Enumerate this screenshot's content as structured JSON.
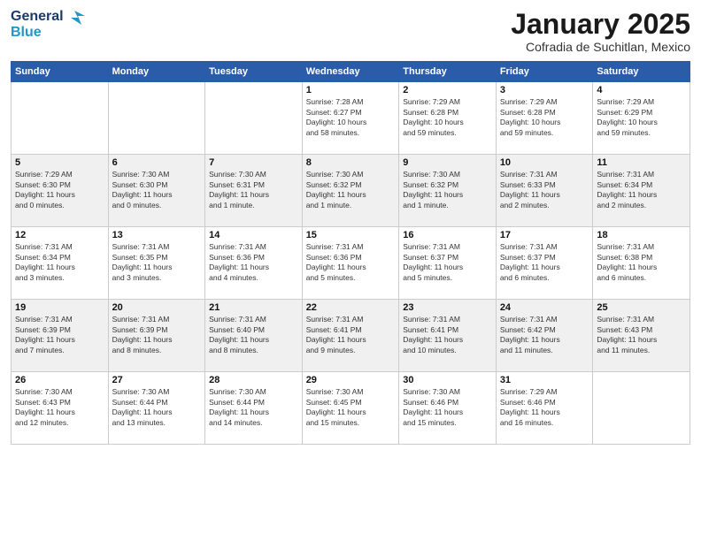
{
  "header": {
    "logo_general": "General",
    "logo_blue": "Blue",
    "month_title": "January 2025",
    "location": "Cofradia de Suchitlan, Mexico"
  },
  "weekdays": [
    "Sunday",
    "Monday",
    "Tuesday",
    "Wednesday",
    "Thursday",
    "Friday",
    "Saturday"
  ],
  "weeks": [
    [
      {
        "day": "",
        "info": ""
      },
      {
        "day": "",
        "info": ""
      },
      {
        "day": "",
        "info": ""
      },
      {
        "day": "1",
        "info": "Sunrise: 7:28 AM\nSunset: 6:27 PM\nDaylight: 10 hours\nand 58 minutes."
      },
      {
        "day": "2",
        "info": "Sunrise: 7:29 AM\nSunset: 6:28 PM\nDaylight: 10 hours\nand 59 minutes."
      },
      {
        "day": "3",
        "info": "Sunrise: 7:29 AM\nSunset: 6:28 PM\nDaylight: 10 hours\nand 59 minutes."
      },
      {
        "day": "4",
        "info": "Sunrise: 7:29 AM\nSunset: 6:29 PM\nDaylight: 10 hours\nand 59 minutes."
      }
    ],
    [
      {
        "day": "5",
        "info": "Sunrise: 7:29 AM\nSunset: 6:30 PM\nDaylight: 11 hours\nand 0 minutes."
      },
      {
        "day": "6",
        "info": "Sunrise: 7:30 AM\nSunset: 6:30 PM\nDaylight: 11 hours\nand 0 minutes."
      },
      {
        "day": "7",
        "info": "Sunrise: 7:30 AM\nSunset: 6:31 PM\nDaylight: 11 hours\nand 1 minute."
      },
      {
        "day": "8",
        "info": "Sunrise: 7:30 AM\nSunset: 6:32 PM\nDaylight: 11 hours\nand 1 minute."
      },
      {
        "day": "9",
        "info": "Sunrise: 7:30 AM\nSunset: 6:32 PM\nDaylight: 11 hours\nand 1 minute."
      },
      {
        "day": "10",
        "info": "Sunrise: 7:31 AM\nSunset: 6:33 PM\nDaylight: 11 hours\nand 2 minutes."
      },
      {
        "day": "11",
        "info": "Sunrise: 7:31 AM\nSunset: 6:34 PM\nDaylight: 11 hours\nand 2 minutes."
      }
    ],
    [
      {
        "day": "12",
        "info": "Sunrise: 7:31 AM\nSunset: 6:34 PM\nDaylight: 11 hours\nand 3 minutes."
      },
      {
        "day": "13",
        "info": "Sunrise: 7:31 AM\nSunset: 6:35 PM\nDaylight: 11 hours\nand 3 minutes."
      },
      {
        "day": "14",
        "info": "Sunrise: 7:31 AM\nSunset: 6:36 PM\nDaylight: 11 hours\nand 4 minutes."
      },
      {
        "day": "15",
        "info": "Sunrise: 7:31 AM\nSunset: 6:36 PM\nDaylight: 11 hours\nand 5 minutes."
      },
      {
        "day": "16",
        "info": "Sunrise: 7:31 AM\nSunset: 6:37 PM\nDaylight: 11 hours\nand 5 minutes."
      },
      {
        "day": "17",
        "info": "Sunrise: 7:31 AM\nSunset: 6:37 PM\nDaylight: 11 hours\nand 6 minutes."
      },
      {
        "day": "18",
        "info": "Sunrise: 7:31 AM\nSunset: 6:38 PM\nDaylight: 11 hours\nand 6 minutes."
      }
    ],
    [
      {
        "day": "19",
        "info": "Sunrise: 7:31 AM\nSunset: 6:39 PM\nDaylight: 11 hours\nand 7 minutes."
      },
      {
        "day": "20",
        "info": "Sunrise: 7:31 AM\nSunset: 6:39 PM\nDaylight: 11 hours\nand 8 minutes."
      },
      {
        "day": "21",
        "info": "Sunrise: 7:31 AM\nSunset: 6:40 PM\nDaylight: 11 hours\nand 8 minutes."
      },
      {
        "day": "22",
        "info": "Sunrise: 7:31 AM\nSunset: 6:41 PM\nDaylight: 11 hours\nand 9 minutes."
      },
      {
        "day": "23",
        "info": "Sunrise: 7:31 AM\nSunset: 6:41 PM\nDaylight: 11 hours\nand 10 minutes."
      },
      {
        "day": "24",
        "info": "Sunrise: 7:31 AM\nSunset: 6:42 PM\nDaylight: 11 hours\nand 11 minutes."
      },
      {
        "day": "25",
        "info": "Sunrise: 7:31 AM\nSunset: 6:43 PM\nDaylight: 11 hours\nand 11 minutes."
      }
    ],
    [
      {
        "day": "26",
        "info": "Sunrise: 7:30 AM\nSunset: 6:43 PM\nDaylight: 11 hours\nand 12 minutes."
      },
      {
        "day": "27",
        "info": "Sunrise: 7:30 AM\nSunset: 6:44 PM\nDaylight: 11 hours\nand 13 minutes."
      },
      {
        "day": "28",
        "info": "Sunrise: 7:30 AM\nSunset: 6:44 PM\nDaylight: 11 hours\nand 14 minutes."
      },
      {
        "day": "29",
        "info": "Sunrise: 7:30 AM\nSunset: 6:45 PM\nDaylight: 11 hours\nand 15 minutes."
      },
      {
        "day": "30",
        "info": "Sunrise: 7:30 AM\nSunset: 6:46 PM\nDaylight: 11 hours\nand 15 minutes."
      },
      {
        "day": "31",
        "info": "Sunrise: 7:29 AM\nSunset: 6:46 PM\nDaylight: 11 hours\nand 16 minutes."
      },
      {
        "day": "",
        "info": ""
      }
    ]
  ]
}
